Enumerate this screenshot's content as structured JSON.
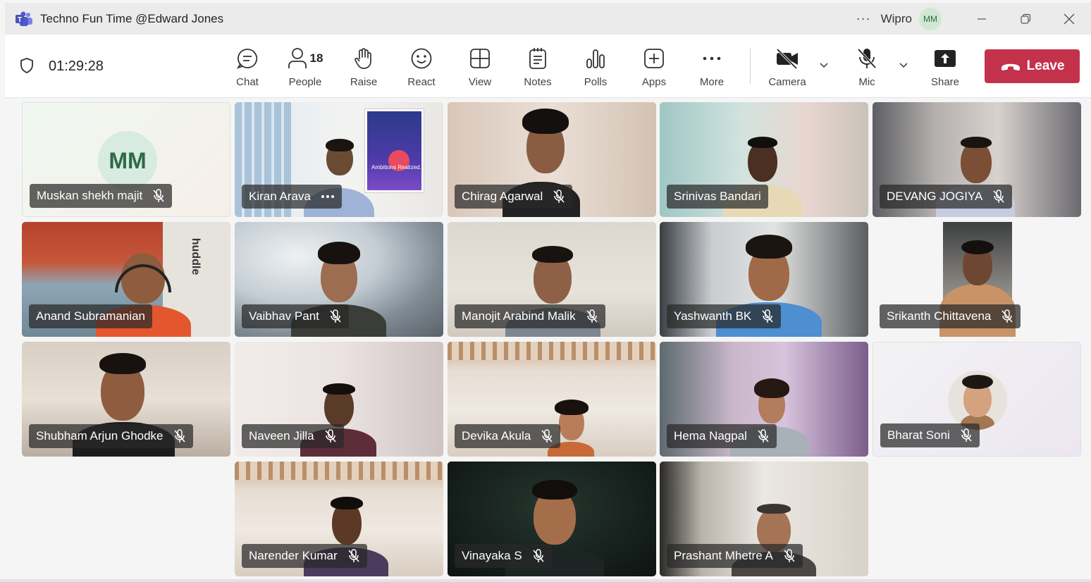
{
  "window": {
    "title": "Techno Fun Time @Edward Jones",
    "more_label": "···",
    "org": "Wipro",
    "user_initials": "MM"
  },
  "toolbar": {
    "timer": "01:29:28",
    "chat": "Chat",
    "people": "People",
    "people_count": "18",
    "raise": "Raise",
    "react": "React",
    "view": "View",
    "notes": "Notes",
    "polls": "Polls",
    "apps": "Apps",
    "more": "More",
    "camera": "Camera",
    "mic": "Mic",
    "share": "Share",
    "leave": "Leave"
  },
  "colors": {
    "leave": "#c4314b",
    "avatar_bg": "#d7ebe0",
    "avatar_text": "#2d6a46"
  },
  "participants": [
    {
      "name": "Muskan shekh majit",
      "initials": "MM",
      "status": "muted"
    },
    {
      "name": "Kiran Arava",
      "status": "more",
      "poster_text": "Ambitions Realized."
    },
    {
      "name": "Chirag Agarwal",
      "status": "muted"
    },
    {
      "name": "Srinivas Bandari",
      "status": "none"
    },
    {
      "name": "DEVANG JOGIYA",
      "status": "muted"
    },
    {
      "name": "Anand Subramanian",
      "status": "none",
      "background_text": "huddle"
    },
    {
      "name": "Vaibhav Pant",
      "status": "muted"
    },
    {
      "name": "Manojit Arabind Malik",
      "status": "muted"
    },
    {
      "name": "Yashwanth BK",
      "status": "muted"
    },
    {
      "name": "Srikanth Chittavena",
      "status": "muted"
    },
    {
      "name": "Shubham Arjun Ghodke",
      "status": "muted"
    },
    {
      "name": "Naveen Jilla",
      "status": "muted"
    },
    {
      "name": "Devika Akula",
      "status": "muted"
    },
    {
      "name": "Hema Nagpal",
      "status": "muted"
    },
    {
      "name": "Bharat Soni",
      "status": "muted"
    },
    {
      "name": "Narender Kumar",
      "status": "muted"
    },
    {
      "name": "Vinayaka S",
      "status": "muted"
    },
    {
      "name": "Prashant Mhetre A",
      "status": "muted"
    }
  ]
}
